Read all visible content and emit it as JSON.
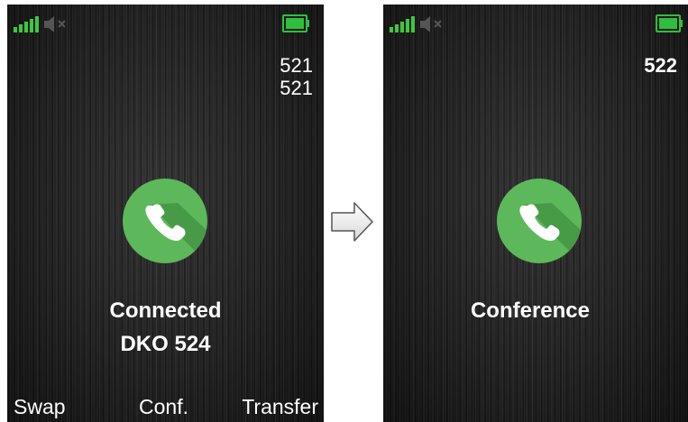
{
  "before": {
    "line_number_1": "521",
    "line_number_2": "521",
    "status": "Connected",
    "caller": "DKO 524",
    "softkeys": {
      "left": "Swap",
      "center": "Conf.",
      "right": "Transfer"
    }
  },
  "after": {
    "line_number": "522",
    "status": "Conference"
  },
  "colors": {
    "accent_green": "#5cb85a",
    "signal_green": "#3fc73f",
    "battery_green": "#2fbf3f"
  },
  "icons": {
    "signal": "signal-bars-icon",
    "mute": "speaker-muted-icon",
    "battery": "battery-icon",
    "call": "phone-handset-icon",
    "transition": "right-arrow-icon"
  }
}
